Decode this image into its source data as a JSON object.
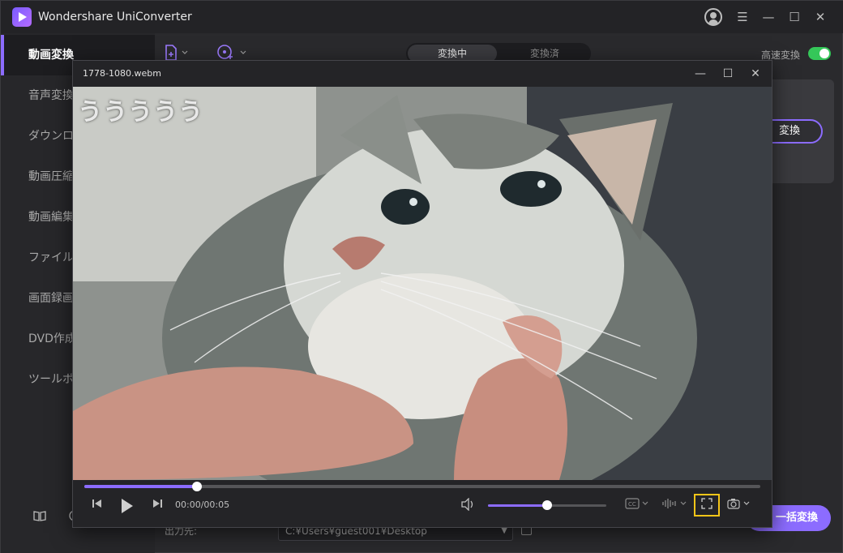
{
  "app": {
    "title": "Wondershare UniConverter",
    "accent": "#8c6cff"
  },
  "window_controls": {
    "user": "user-icon",
    "menu": "☰",
    "minimize": "—",
    "maximize": "☐",
    "close": "✕"
  },
  "sidebar": {
    "items": [
      {
        "label": "動画変換",
        "active": true
      },
      {
        "label": "音声変換",
        "active": false
      },
      {
        "label": "ダウンロード",
        "active": false
      },
      {
        "label": "動画圧縮",
        "active": false
      },
      {
        "label": "動画編集",
        "active": false
      },
      {
        "label": "ファイル結合",
        "active": false
      },
      {
        "label": "画面録画",
        "active": false
      },
      {
        "label": "DVD作成",
        "active": false
      },
      {
        "label": "ツールボックス",
        "active": false
      }
    ],
    "bottom_icons": [
      "book-icon",
      "help-icon"
    ]
  },
  "toolbar": {
    "add_file_icon": "add-file-icon",
    "add_dvd_icon": "add-disc-icon",
    "tabs": {
      "converting": "変換中",
      "converted": "変換済"
    },
    "fast_convert_label": "高速変換",
    "fast_convert_on": true
  },
  "item": {
    "convert_button": "変換"
  },
  "footer": {
    "output_label": "出力先:",
    "output_path": "C:¥Users¥guest001¥Desktop",
    "bulk_convert_button": "一括変換"
  },
  "player": {
    "filename": "1778-1080.webm",
    "caption_text": "ううううう",
    "time_display": "00:00/00:05",
    "progress": 0.167,
    "volume": 0.5,
    "buttons": {
      "prev": "prev-frame-icon",
      "play": "play-icon",
      "next": "next-frame-icon",
      "volume": "volume-icon",
      "subtitle": "subtitle-icon",
      "audio_track": "audio-track-icon",
      "fullscreen": "fullscreen-icon",
      "snapshot": "camera-icon"
    }
  }
}
